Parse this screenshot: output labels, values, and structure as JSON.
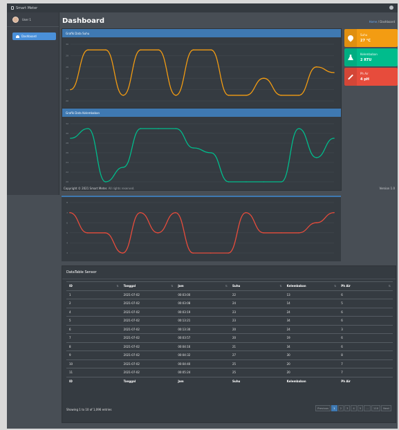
{
  "app": {
    "brand": "Smart Meter",
    "user": "User 1",
    "nav_dashboard": "Dashboard"
  },
  "page": {
    "title": "Dashboard",
    "breadcrumb_home": "Home",
    "breadcrumb_sep": "/",
    "breadcrumb_current": "Dashboard"
  },
  "panels": {
    "suhu_title": "Grafik Data Suhu",
    "kelembaban_title": "Grafik Data Kelembaban"
  },
  "info_cards": [
    {
      "label": "Suhu",
      "value": "27 °C",
      "color": "#f39c12",
      "icon": "flame-icon"
    },
    {
      "label": "Kelembaban",
      "value": "2 RTU",
      "color": "#00bc8c",
      "icon": "flask-icon"
    },
    {
      "label": "Ph Air",
      "value": "4 pH",
      "color": "#e74c3c",
      "icon": "pencil-icon"
    }
  ],
  "footer": {
    "copyright": "Copyright © 2021 Smart Meter.",
    "rights": "All rights reserved.",
    "version": "Version 1.0"
  },
  "table": {
    "title": "DataTable Sensor",
    "columns": [
      "ID",
      "Tanggal",
      "Jam",
      "Suhu",
      "Kelembaban",
      "Ph Air"
    ],
    "rows": [
      [
        "1",
        "2021-07-02",
        "00:03:00",
        "22",
        "13",
        "6"
      ],
      [
        "2",
        "2021-07-02",
        "00:03:08",
        "24",
        "14",
        "5"
      ],
      [
        "4",
        "2021-07-02",
        "00:03:19",
        "23",
        "24",
        "6"
      ],
      [
        "5",
        "2021-07-02",
        "00:13:21",
        "23",
        "34",
        "6"
      ],
      [
        "6",
        "2021-07-02",
        "00:13:30",
        "20",
        "24",
        "3"
      ],
      [
        "7",
        "2021-07-02",
        "00:03:57",
        "20",
        "19",
        "6"
      ],
      [
        "8",
        "2021-07-02",
        "00:04:16",
        "21",
        "34",
        "6"
      ],
      [
        "9",
        "2021-07-02",
        "00:04:32",
        "27",
        "30",
        "8"
      ],
      [
        "10",
        "2021-07-02",
        "00:04:40",
        "25",
        "20",
        "7"
      ],
      [
        "11",
        "2021-07-02",
        "00:05:24",
        "25",
        "20",
        "7"
      ]
    ],
    "info": "Showing 1 to 10 of 1,096 entries",
    "pagination": [
      "Previous",
      "1",
      "2",
      "3",
      "4",
      "5",
      "...",
      "110",
      "Next"
    ]
  },
  "chart_data": [
    {
      "type": "line",
      "title": "Grafik Data Suhu",
      "series": [
        {
          "values": [
            22,
            29,
            29,
            21,
            29,
            29,
            21,
            29,
            29,
            21,
            21,
            24,
            21,
            21,
            26,
            25
          ],
          "color": "#f39c12"
        }
      ],
      "ylim": [
        20,
        30
      ],
      "yticks": [
        "30",
        "28",
        "26",
        "24",
        "22",
        "20"
      ]
    },
    {
      "type": "line",
      "title": "Grafik Data Kelembaban",
      "series": [
        {
          "values": [
            29,
            31,
            20,
            23,
            31,
            31,
            31,
            27,
            26,
            20,
            20,
            20,
            20,
            31,
            25,
            29
          ],
          "color": "#00bc8c"
        }
      ],
      "ylim": [
        20,
        32
      ],
      "yticks": [
        "32",
        "30",
        "28",
        "26",
        "24",
        "22",
        "20"
      ]
    },
    {
      "type": "line",
      "series": [
        {
          "values": [
            7,
            5,
            5,
            3,
            7,
            5,
            7,
            3,
            3,
            3,
            7,
            5,
            5,
            5,
            6,
            7
          ],
          "color": "#e74c3c"
        }
      ],
      "ylim": [
        3,
        8
      ],
      "yticks": [
        "8",
        "7",
        "6",
        "5",
        "4",
        "3"
      ]
    }
  ]
}
